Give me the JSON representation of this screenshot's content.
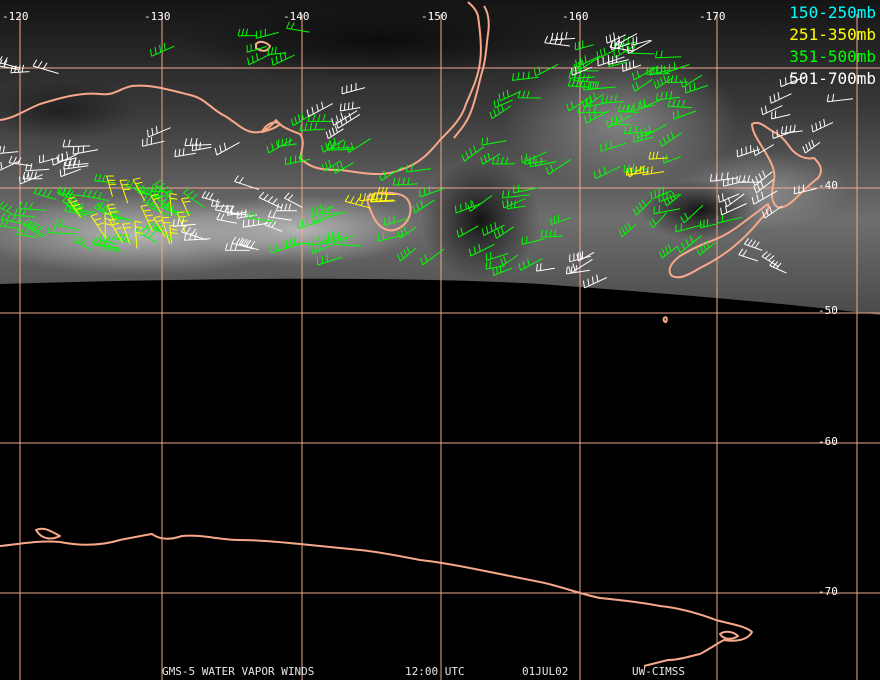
{
  "map": {
    "longitude_labels": [
      "-120",
      "-130",
      "-140",
      "-150",
      "-160",
      "-170"
    ],
    "latitude_labels": [
      "-40",
      "-50",
      "-60",
      "-70"
    ]
  },
  "legend": [
    {
      "label": "150-250mb",
      "color": "#00ffff"
    },
    {
      "label": "251-350mb",
      "color": "#ffff00"
    },
    {
      "label": "351-500mb",
      "color": "#00ff00"
    },
    {
      "label": "501-700mb",
      "color": "#ffffff"
    }
  ],
  "footer": {
    "product": "GMS-5 WATER VAPOR WINDS",
    "time": "12:00 UTC",
    "date": "01JUL02",
    "source": "UW-CIMSS"
  },
  "colors": {
    "graticule": "#f0a890",
    "coastline": "#f8a88a",
    "background": "#000000"
  }
}
